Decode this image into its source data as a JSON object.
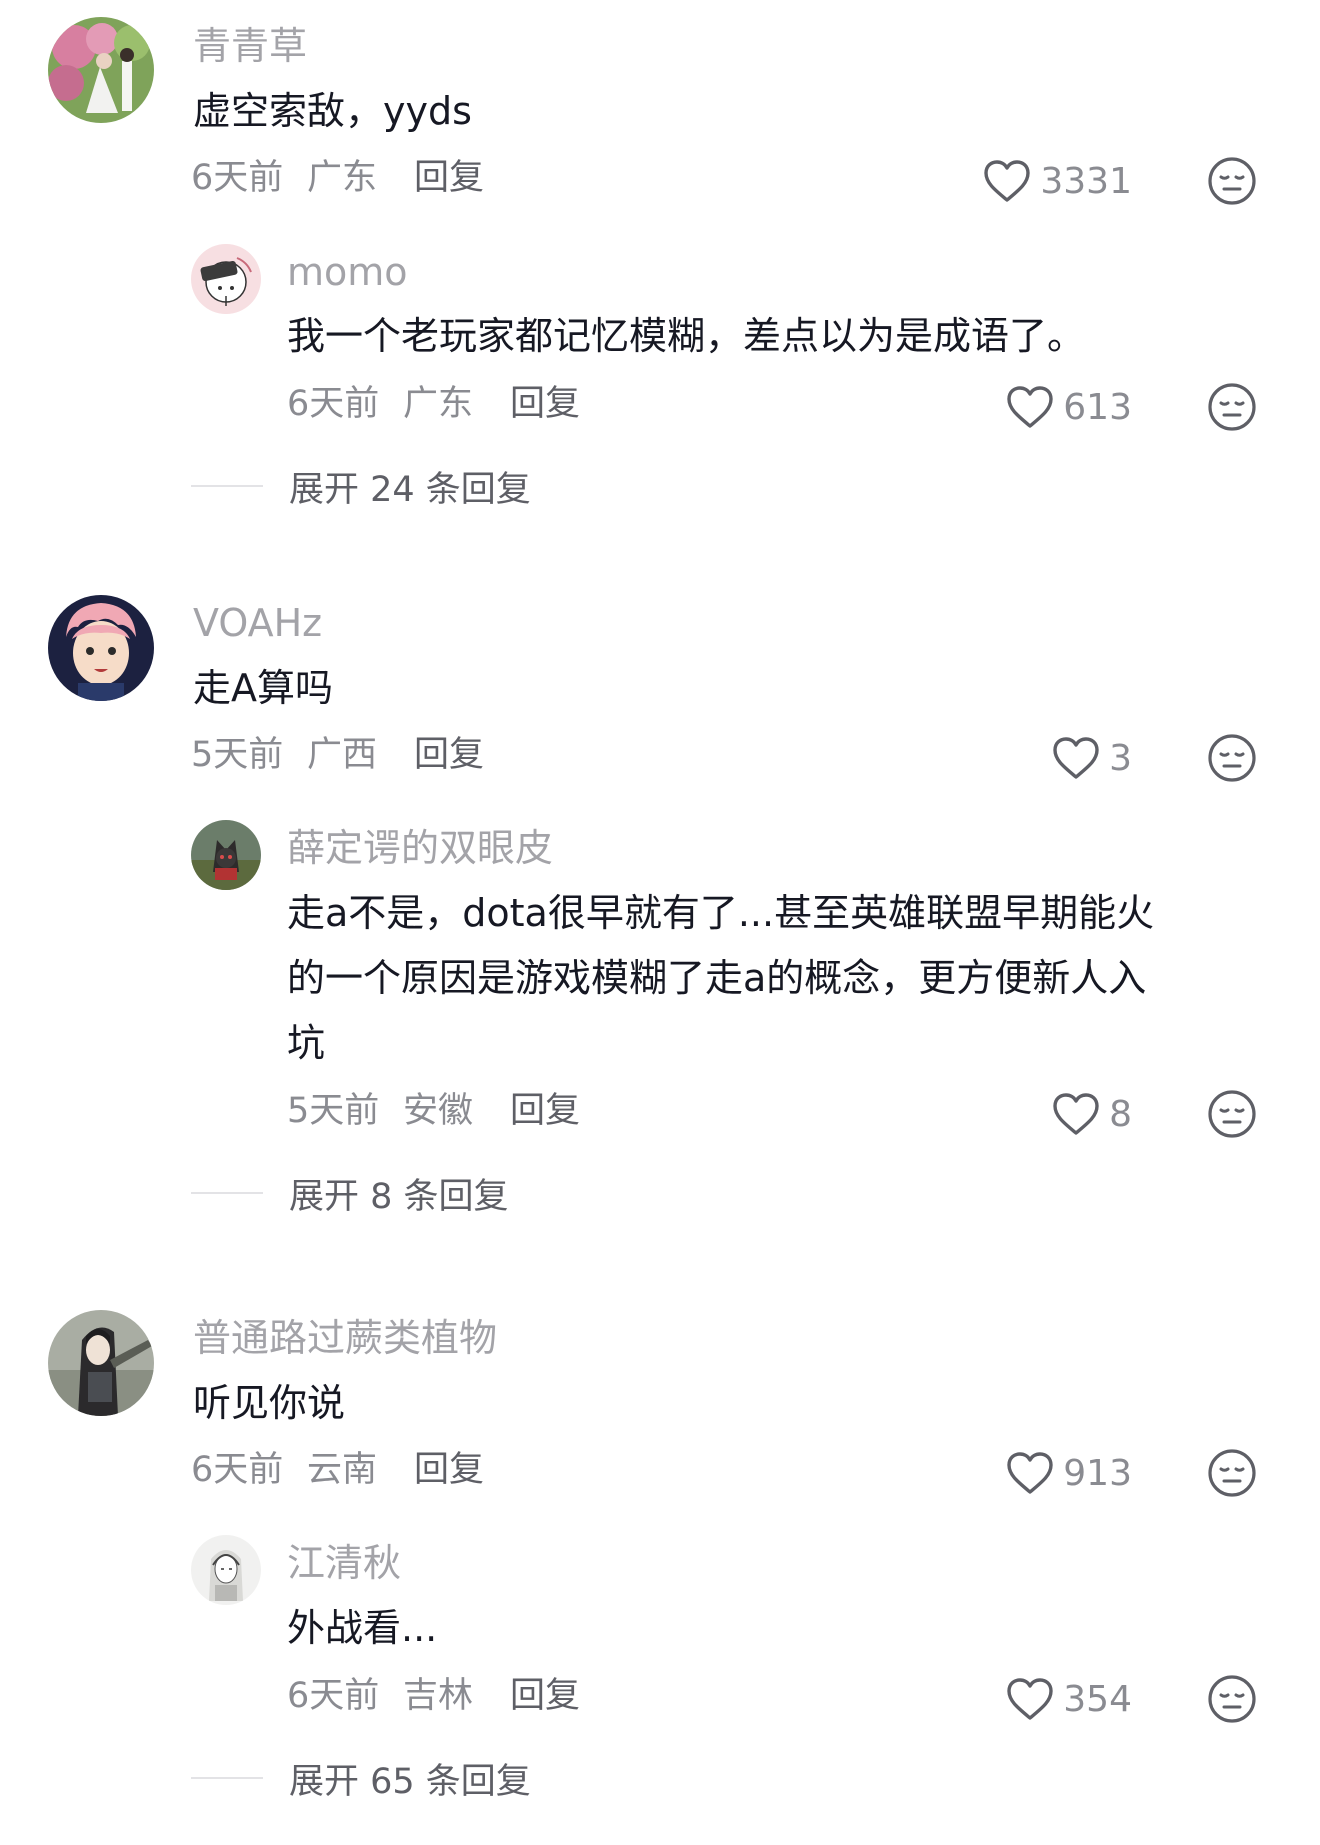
{
  "comments": [
    {
      "username": "青青草",
      "text": "虚空索敌，yyds",
      "time": "6天前",
      "location": "广东",
      "reply_label": "回复",
      "likes": "3331",
      "reply": {
        "username": "momo",
        "text": "我一个老玩家都记忆模糊，差点以为是成语了。",
        "time": "6天前",
        "location": "广东",
        "reply_label": "回复",
        "likes": "613"
      },
      "expand_label": "展开 24 条回复"
    },
    {
      "username": "VOAHz",
      "text": "走A算吗",
      "time": "5天前",
      "location": "广西",
      "reply_label": "回复",
      "likes": "3",
      "reply": {
        "username": "薛定谔的双眼皮",
        "text_lines": [
          "走a不是，dota很早就有了...甚至英雄联盟早期能火",
          "的一个原因是游戏模糊了走a的概念，更方便新人入",
          "坑"
        ],
        "time": "5天前",
        "location": "安徽",
        "reply_label": "回复",
        "likes": "8"
      },
      "expand_label": "展开 8 条回复"
    },
    {
      "username": "普通路过蕨类植物",
      "text": "听见你说",
      "time": "6天前",
      "location": "云南",
      "reply_label": "回复",
      "likes": "913",
      "reply": {
        "username": "江清秋",
        "text": "外战看...",
        "time": "6天前",
        "location": "吉林",
        "reply_label": "回复",
        "likes": "354"
      },
      "expand_label": "展开 65 条回复"
    }
  ],
  "icons": {
    "like": "heart-outline-icon",
    "dislike": "neutral-face-icon"
  },
  "colors": {
    "username": "#a3a3a8",
    "text": "#161823",
    "meta": "#8a8b91",
    "action": "#5e5f66"
  }
}
